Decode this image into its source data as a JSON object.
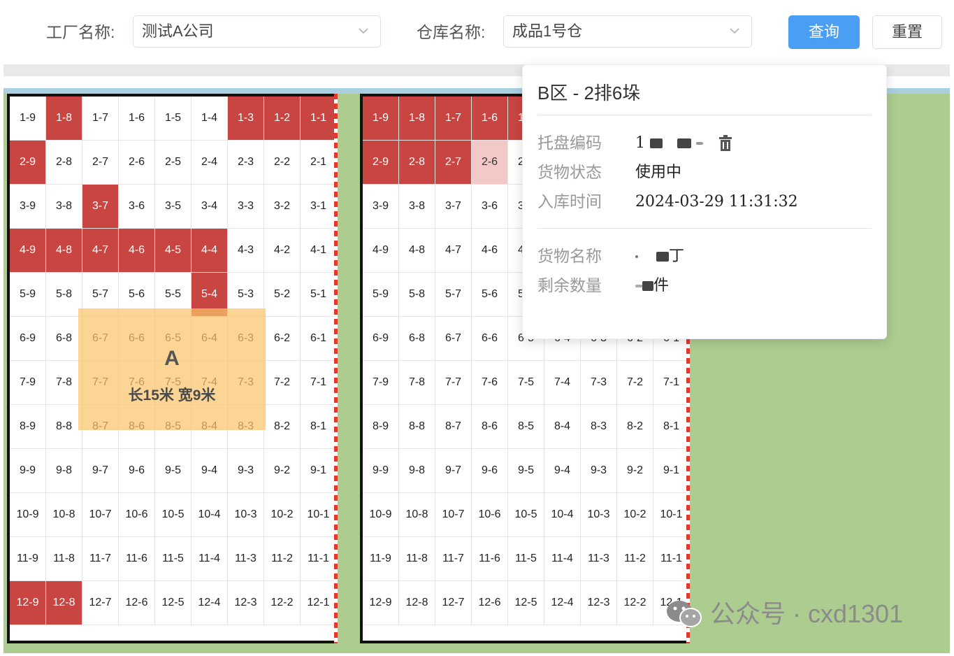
{
  "filters": {
    "factory_label": "工厂名称:",
    "factory_value": "测试A公司",
    "warehouse_label": "仓库名称:",
    "warehouse_value": "成品1号仓",
    "query_label": "查询",
    "reset_label": "重置"
  },
  "colors": {
    "occupied": "#c84542",
    "selected": "#f3c9c8",
    "primary": "#4a9ff5",
    "floor": "#adcc90",
    "area": "#fbc469"
  },
  "blocks": [
    {
      "name": "left-block",
      "rows": 12,
      "cols": 9,
      "occupied": [
        "1-8",
        "1-3",
        "1-2",
        "1-1",
        "2-9",
        "3-7",
        "4-9",
        "4-8",
        "4-7",
        "4-6",
        "4-5",
        "4-4",
        "5-4",
        "12-9",
        "12-8"
      ],
      "selected": []
    },
    {
      "name": "right-block",
      "rows": 12,
      "cols": 9,
      "occupied": [
        "1-9",
        "1-8",
        "1-7",
        "1-6",
        "1-5",
        "2-9",
        "2-8",
        "2-7"
      ],
      "selected": [
        "2-6"
      ]
    }
  ],
  "area": {
    "name": "A",
    "size_text": "长15米 宽9米"
  },
  "popover": {
    "title": "B区 - 2排6垛",
    "pallet_code_label": "托盘编码",
    "pallet_code_value": "1 ",
    "status_label": "货物状态",
    "status_value": "使用中",
    "inbound_label": "入库时间",
    "inbound_value": "2024-03-29 11:31:32",
    "goods_label": "货物名称",
    "goods_value": "丁",
    "remaining_label": "剩余数量",
    "remaining_value": "件",
    "trash_icon": "trash-icon"
  },
  "watermark": {
    "text": "公众号 · cxd1301",
    "icon": "wechat-icon"
  }
}
